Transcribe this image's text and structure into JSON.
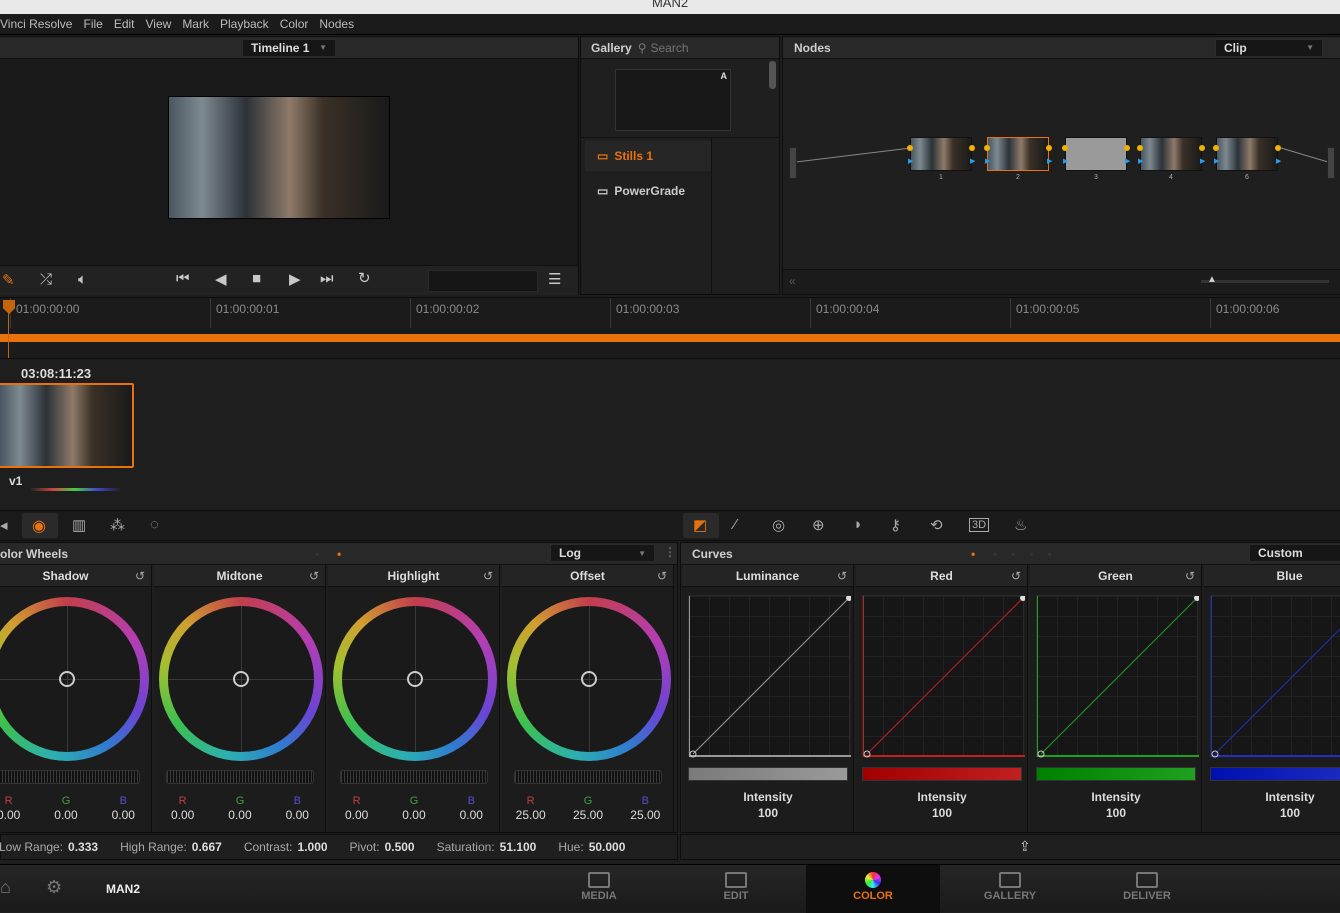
{
  "window": {
    "title": "MAN2"
  },
  "menu": [
    "Vinci Resolve",
    "File",
    "Edit",
    "View",
    "Mark",
    "Playback",
    "Color",
    "Nodes"
  ],
  "viewer": {
    "timeline": "Timeline 1"
  },
  "gallery": {
    "title": "Gallery",
    "search_placeholder": "Search",
    "still_badge": "A",
    "albums": [
      "Stills 1",
      "PowerGrade"
    ]
  },
  "nodes": {
    "title": "Nodes",
    "mode": "Clip",
    "items": [
      "1",
      "2",
      "3",
      "4",
      "6"
    ],
    "selected": "2"
  },
  "timeline": {
    "ticks": [
      "01:00:00:00",
      "01:00:00:01",
      "01:00:00:02",
      "01:00:00:03",
      "01:00:00:04",
      "01:00:00:05",
      "01:00:00:06"
    ]
  },
  "clip": {
    "timecode": "03:08:11:23",
    "track": "v1"
  },
  "color_wheels": {
    "title": "olor Wheels",
    "mode": "Log",
    "wheels": [
      {
        "name": "Shadow",
        "r": "0.00",
        "g": "0.00",
        "b": "0.00"
      },
      {
        "name": "Midtone",
        "r": "0.00",
        "g": "0.00",
        "b": "0.00"
      },
      {
        "name": "Highlight",
        "r": "0.00",
        "g": "0.00",
        "b": "0.00"
      },
      {
        "name": "Offset",
        "r": "25.00",
        "g": "25.00",
        "b": "25.00"
      }
    ]
  },
  "curves": {
    "title": "Curves",
    "mode": "Custom",
    "channels": [
      {
        "name": "Luminance",
        "label": "Intensity",
        "value": "100",
        "color": "#9a9a9a",
        "bar": "#7a7a7a"
      },
      {
        "name": "Red",
        "label": "Intensity",
        "value": "100",
        "color": "#c02020",
        "bar": "#a00000"
      },
      {
        "name": "Green",
        "label": "Intensity",
        "value": "100",
        "color": "#20a020",
        "bar": "#008000"
      },
      {
        "name": "Blue",
        "label": "Intensity",
        "value": "100",
        "color": "#2030c0",
        "bar": "#0010b0"
      }
    ]
  },
  "params": [
    {
      "label": "Low Range:",
      "value": "0.333"
    },
    {
      "label": "High Range:",
      "value": "0.667"
    },
    {
      "label": "Contrast:",
      "value": "1.000"
    },
    {
      "label": "Pivot:",
      "value": "0.500"
    },
    {
      "label": "Saturation:",
      "value": "51.100"
    },
    {
      "label": "Hue:",
      "value": "50.000"
    }
  ],
  "project": "MAN2",
  "pages": [
    {
      "label": "MEDIA"
    },
    {
      "label": "EDIT"
    },
    {
      "label": "COLOR",
      "active": true
    },
    {
      "label": "GALLERY"
    },
    {
      "label": "DELIVER"
    }
  ],
  "colors": {
    "accent": "#e8720c"
  }
}
